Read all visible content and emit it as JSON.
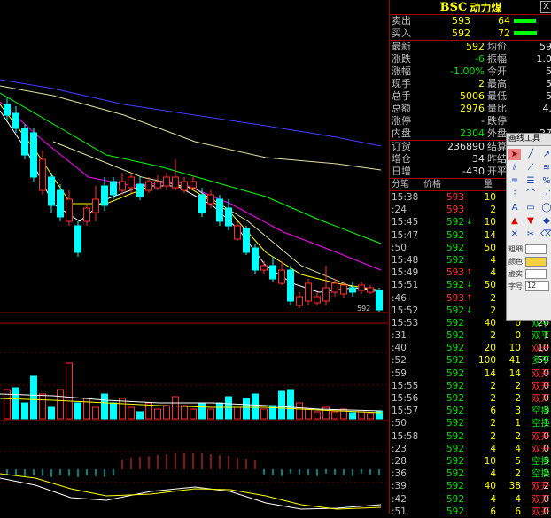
{
  "header": {
    "code": "BSC",
    "name": "动力煤",
    "close_label": "X"
  },
  "quote_top": [
    {
      "label": "卖出",
      "price": "593",
      "vol": "64",
      "bar_fraction": 0.95
    },
    {
      "label": "买入",
      "price": "592",
      "vol": "72",
      "bar_fraction": 1.0
    }
  ],
  "quote_rows": [
    {
      "l1": "最新",
      "v1": "592",
      "c1": "yellow",
      "l2": "均价",
      "v2": "59"
    },
    {
      "l1": "涨跌",
      "v1": "-6",
      "c1": "green",
      "l2": "振幅",
      "v2": "1.0"
    },
    {
      "l1": "涨幅",
      "v1": "-1.00%",
      "c1": "green",
      "l2": "今开",
      "v2": "5"
    },
    {
      "l1": "现手",
      "v1": "2",
      "c1": "yellow",
      "l2": "最高",
      "v2": "5"
    },
    {
      "l1": "总手",
      "v1": "5006",
      "c1": "yellow",
      "l2": "最低",
      "v2": "5"
    },
    {
      "l1": "总额",
      "v1": "2976",
      "c1": "yellow",
      "l2": "量比",
      "v2": "4."
    },
    {
      "l1": "涨停",
      "v1": "-",
      "c1": "white",
      "l2": "跌停",
      "v2": ""
    },
    {
      "l1": "内盘",
      "v1": "2304",
      "c1": "green",
      "l2": "外盘",
      "v2": "27"
    }
  ],
  "position_rows": [
    {
      "l1": "订货",
      "v1": "236890",
      "c1": "white",
      "l2": "结算",
      "v2": ""
    },
    {
      "l1": "增仓",
      "v1": "34",
      "c1": "white",
      "l2": "昨结",
      "v2": ""
    },
    {
      "l1": "日增",
      "v1": "-430",
      "c1": "white",
      "l2": "开平",
      "v2": ""
    }
  ],
  "ticks_header": {
    "time": "分笔",
    "price": "价格",
    "vol": "量",
    "open": "开",
    "flat": "平"
  },
  "ticks": [
    {
      "time": "15:38",
      "price": "593",
      "arrow": "",
      "vol": "10",
      "open": "5",
      "flat": "",
      "type": ""
    },
    {
      "time": ":24",
      "price": "593",
      "arrow": "",
      "vol": "2",
      "open": "1",
      "flat": "",
      "type": ""
    },
    {
      "time": "15:45",
      "price": "592",
      "arrow": "down",
      "vol": "10",
      "open": "5",
      "flat": "",
      "type": ""
    },
    {
      "time": "15:47",
      "price": "592",
      "arrow": "",
      "vol": "14",
      "open": "11",
      "flat": "",
      "type": ""
    },
    {
      "time": ":50",
      "price": "592",
      "arrow": "",
      "vol": "50",
      "open": "30",
      "flat": "",
      "type": ""
    },
    {
      "time": "15:48",
      "price": "592",
      "arrow": "",
      "vol": "4",
      "open": "2",
      "flat": "",
      "type": ""
    },
    {
      "time": "15:49",
      "price": "593",
      "arrow": "up",
      "vol": "4",
      "open": "2",
      "flat": "",
      "type": ""
    },
    {
      "time": "15:51",
      "price": "592",
      "arrow": "down",
      "vol": "50",
      "open": "25",
      "flat": "",
      "type": ""
    },
    {
      "time": ":46",
      "price": "593",
      "arrow": "up",
      "vol": "2",
      "open": "1",
      "flat": "",
      "type": ""
    },
    {
      "time": "15:52",
      "price": "592",
      "arrow": "down",
      "vol": "2",
      "open": "1",
      "flat": "",
      "type": ""
    },
    {
      "time": "15:53",
      "price": "592",
      "arrow": "",
      "vol": "40",
      "open": "0",
      "flat": "20",
      "type": "双平"
    },
    {
      "time": ":31",
      "price": "592",
      "arrow": "",
      "vol": "2",
      "open": "0",
      "flat": "1",
      "type": "双平"
    },
    {
      "time": ":40",
      "price": "592",
      "arrow": "",
      "vol": "20",
      "open": "10",
      "flat": "10",
      "type": "双开"
    },
    {
      "time": ":52",
      "price": "592",
      "arrow": "",
      "vol": "100",
      "open": "41",
      "flat": "59",
      "type": "多平"
    },
    {
      "time": ":59",
      "price": "592",
      "arrow": "",
      "vol": "14",
      "open": "14",
      "flat": "0",
      "type": "双开"
    },
    {
      "time": "15:55",
      "price": "592",
      "arrow": "",
      "vol": "2",
      "open": "2",
      "flat": "0",
      "type": "双开"
    },
    {
      "time": "15:56",
      "price": "592",
      "arrow": "",
      "vol": "2",
      "open": "2",
      "flat": "0",
      "type": "双开"
    },
    {
      "time": "15:57",
      "price": "592",
      "arrow": "",
      "vol": "6",
      "open": "3",
      "flat": "3",
      "type": "空换"
    },
    {
      "time": ":50",
      "price": "592",
      "arrow": "",
      "vol": "2",
      "open": "1",
      "flat": "1",
      "type": "空换"
    },
    {
      "time": "15:58",
      "price": "592",
      "arrow": "",
      "vol": "2",
      "open": "2",
      "flat": "0",
      "type": "双开"
    },
    {
      "time": ":23",
      "price": "592",
      "arrow": "",
      "vol": "4",
      "open": "4",
      "flat": "0",
      "type": "双开"
    },
    {
      "time": ":28",
      "price": "592",
      "arrow": "",
      "vol": "10",
      "open": "5",
      "flat": "5",
      "type": "空换"
    },
    {
      "time": ":36",
      "price": "592",
      "arrow": "",
      "vol": "4",
      "open": "2",
      "flat": "2",
      "type": "空换"
    },
    {
      "time": ":39",
      "price": "592",
      "arrow": "",
      "vol": "40",
      "open": "38",
      "flat": "2",
      "type": "双开"
    },
    {
      "time": ":42",
      "price": "592",
      "arrow": "",
      "vol": "4",
      "open": "4",
      "flat": "0",
      "type": "双开"
    },
    {
      "time": ":51",
      "price": "592",
      "arrow": "",
      "vol": "6",
      "open": "6",
      "flat": "0",
      "type": "双开"
    }
  ],
  "tool_window": {
    "title": "画线工具",
    "rows": [
      {
        "label": "粗细"
      },
      {
        "label": "颜色"
      },
      {
        "label": "虚实"
      },
      {
        "label": "字号",
        "value": "12"
      }
    ]
  },
  "chart": {
    "last_price_label": "592",
    "colors": {
      "up": "#ff3030",
      "down": "#00ffff",
      "ma5": "#ffffff",
      "ma10": "#ffff00",
      "ma20": "#ff00ff",
      "ma30": "#00ff00",
      "ma60": "#e0e0a0",
      "ma120": "#4040ff"
    }
  }
}
